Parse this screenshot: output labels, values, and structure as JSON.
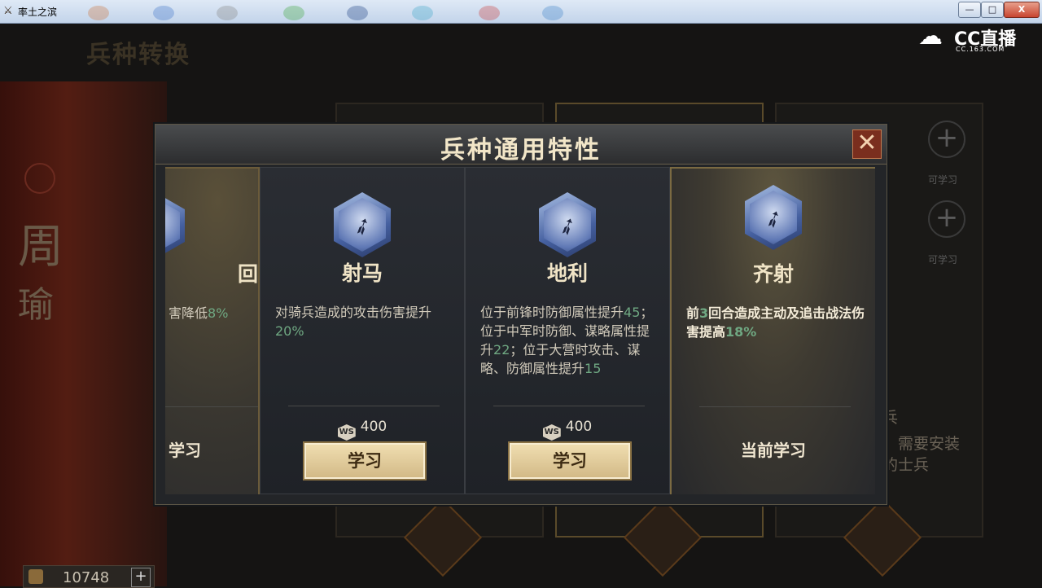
{
  "window": {
    "title": "率土之滨",
    "min": "—",
    "max": "□",
    "close": "X"
  },
  "watermark": {
    "brand": "CC直播",
    "site": "CC.163.COM"
  },
  "background": {
    "screen_title": "兵种转换",
    "hero_name_1": "周",
    "hero_name_2": "瑜",
    "slot_label": "可学习",
    "right_text_1": "兵",
    "right_text_2": "、需要安装",
    "right_text_3": "的士兵",
    "currency_value": "10748",
    "currency_plus": "+"
  },
  "modal": {
    "title": "兵种通用特性",
    "close_label": "✕"
  },
  "cards": [
    {
      "name": "回",
      "desc_pre": "害降低",
      "desc_hl": "8%",
      "action_text": "学习",
      "state": "partial"
    },
    {
      "name": "射马",
      "desc_parts": [
        "对骑兵造成的攻击伤害提升",
        "20%"
      ],
      "cost": "400",
      "button_label": "学习",
      "state": "available"
    },
    {
      "name": "地利",
      "desc_parts": [
        "位于前锋时防御属性提升",
        "45",
        "；位于中军时防御、谋略属性提升",
        "22",
        "；位于大营时攻击、谋略、防御属性提升",
        "15"
      ],
      "cost": "400",
      "button_label": "学习",
      "state": "available"
    },
    {
      "name": "齐射",
      "desc_parts": [
        "前",
        "3",
        "回合造成主动及追击战法伤害提高",
        "18%"
      ],
      "status_text": "当前学习",
      "state": "active"
    }
  ],
  "icons": {
    "skill": "bow-arrow-icon",
    "cost": "copper-token-icon",
    "close": "close-icon"
  },
  "colors": {
    "highlight": "#6fa882",
    "button_gold": "#e1cc9b",
    "close_red": "#7a2e1e",
    "title_text": "#f2e6c8"
  }
}
